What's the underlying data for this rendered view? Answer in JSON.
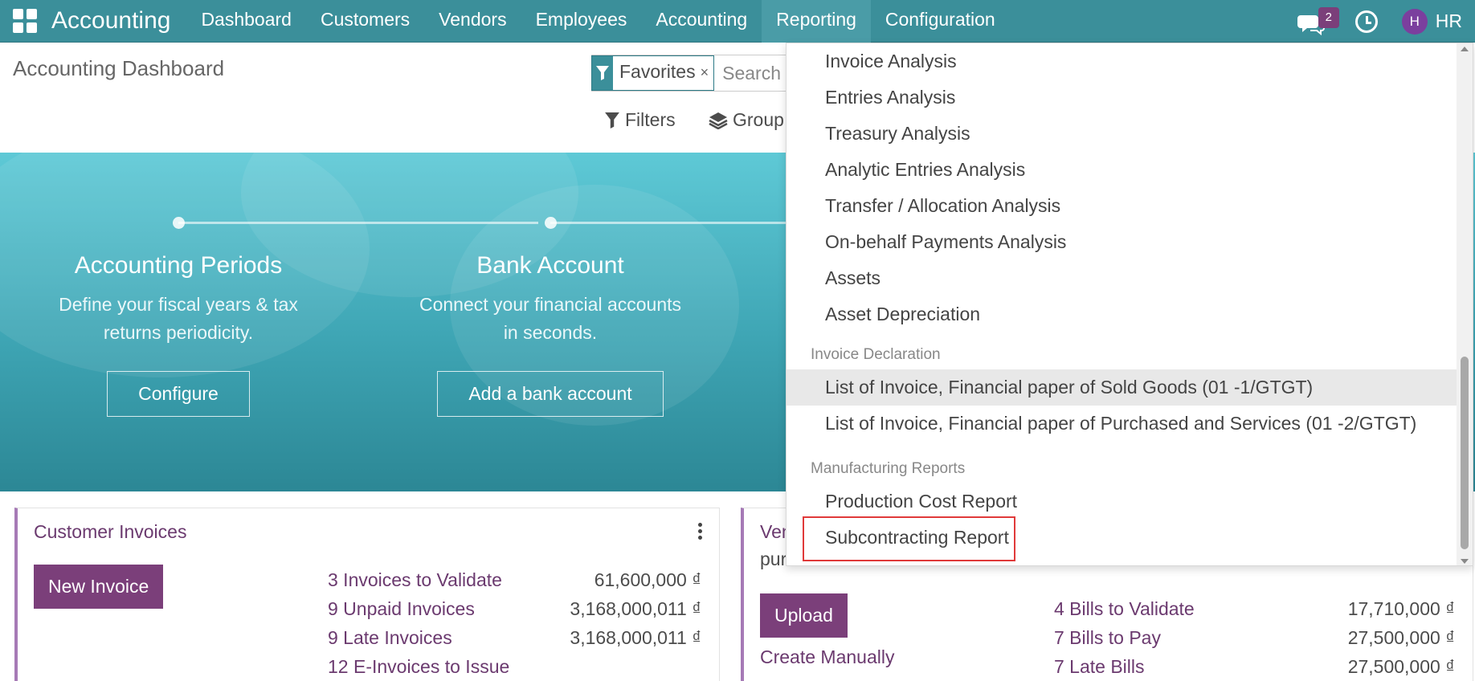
{
  "app": {
    "title": "Accounting"
  },
  "nav": {
    "items": [
      "Dashboard",
      "Customers",
      "Vendors",
      "Employees",
      "Accounting",
      "Reporting",
      "Configuration"
    ],
    "active": "Reporting",
    "messages_count": "2",
    "avatar_initial": "H",
    "user_name": "HR"
  },
  "control": {
    "page_title": "Accounting Dashboard",
    "facet_label": "Favorites",
    "facet_close": "×",
    "search_placeholder": "Search",
    "filters_label": "Filters",
    "group_label": "Group"
  },
  "hero": {
    "steps": [
      {
        "title": "Accounting Periods",
        "desc_line1": "Define your fiscal years & tax",
        "desc_line2": "returns periodicity.",
        "button": "Configure"
      },
      {
        "title": "Bank Account",
        "desc_line1": "Connect your financial accounts",
        "desc_line2": "in seconds.",
        "button": "Add a bank account"
      }
    ]
  },
  "customer_card": {
    "title": "Customer Invoices",
    "primary_button": "New Invoice",
    "stats": [
      {
        "label": "3 Invoices to Validate",
        "value": "61,600,000 ₫"
      },
      {
        "label": "9 Unpaid Invoices",
        "value": "3,168,000,011 ₫"
      },
      {
        "label": "9 Late Invoices",
        "value": "3,168,000,011 ₫"
      },
      {
        "label": "12 E-Invoices to Issue",
        "value": ""
      }
    ]
  },
  "vendor_card": {
    "title_partial": "Ven",
    "subtitle_partial": "pur",
    "primary_button": "Upload",
    "secondary_link": "Create Manually",
    "stats": [
      {
        "label": "4 Bills to Validate",
        "value": "17,710,000 ₫"
      },
      {
        "label": "7 Bills to Pay",
        "value": "27,500,000 ₫"
      },
      {
        "label": "7 Late Bills",
        "value": "27,500,000 ₫"
      }
    ]
  },
  "reporting_menu": {
    "items_top": [
      "Invoice Analysis",
      "Entries Analysis",
      "Treasury Analysis",
      "Analytic Entries Analysis",
      "Transfer / Allocation Analysis",
      "On-behalf Payments Analysis",
      "Assets",
      "Asset Depreciation"
    ],
    "section_invoice_declaration": "Invoice Declaration",
    "items_invoice_declaration": [
      "List of Invoice, Financial paper of Sold Goods (01 -1/GTGT)",
      "List of Invoice, Financial paper of Purchased and Services (01 -2/GTGT)"
    ],
    "section_manufacturing": "Manufacturing Reports",
    "items_manufacturing": [
      "Production Cost Report",
      "Subcontracting Report"
    ],
    "highlight_color": "#e03a3a"
  }
}
